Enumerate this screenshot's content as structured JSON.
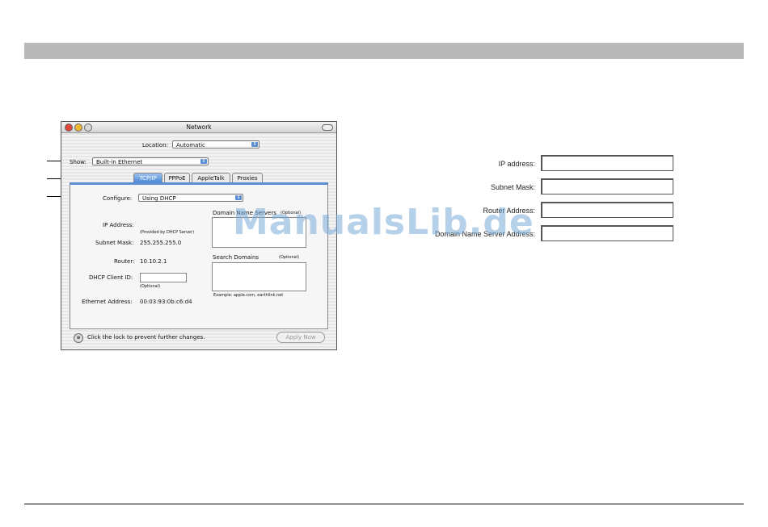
{
  "window": {
    "title": "Network",
    "location_label": "Location:",
    "location_value": "Automatic",
    "show_label": "Show:",
    "show_value": "Built-in Ethernet",
    "tabs": [
      "TCP/IP",
      "PPPoE",
      "AppleTalk",
      "Proxies"
    ],
    "configure_label": "Configure:",
    "configure_value": "Using DHCP",
    "ip_label": "IP Address:",
    "ip_note": "(Provided by DHCP Server)",
    "subnet_label": "Subnet Mask:",
    "subnet_value": "255.255.255.0",
    "router_label": "Router:",
    "router_value": "10.10.2.1",
    "dhcp_label": "DHCP Client ID:",
    "dhcp_note": "(Optional)",
    "ethernet_label": "Ethernet Address:",
    "ethernet_value": "00:03:93:0b:c6:d4",
    "dns_label": "Domain Name Servers",
    "dns_optional": "(Optional)",
    "search_label": "Search Domains",
    "search_optional": "(Optional)",
    "example_text": "Example: apple.com, earthlink.net",
    "lock_text": "Click the lock to prevent further changes.",
    "apply_label": "Apply Now"
  },
  "form": {
    "ip_address_label": "IP address:",
    "subnet_mask_label": "Subnet Mask:",
    "router_address_label": "Router Address:",
    "dns_address_label": "Domain Name Server Address:"
  },
  "watermark": "ManualsLib.de"
}
